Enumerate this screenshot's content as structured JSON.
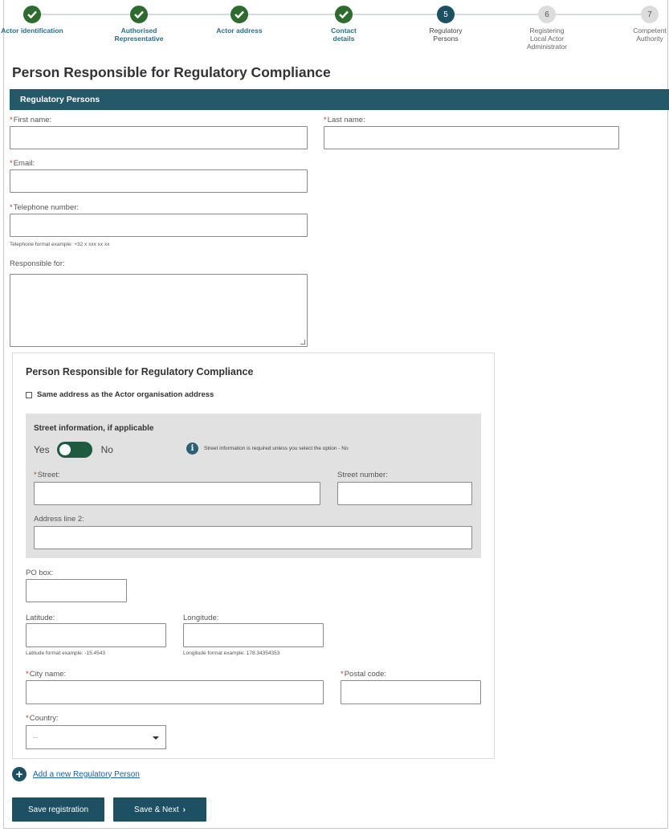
{
  "stepper": {
    "steps": [
      {
        "number": "",
        "label": "Actor identification",
        "state": "done"
      },
      {
        "number": "",
        "label": "Authorised Representative",
        "state": "done"
      },
      {
        "number": "",
        "label": "Actor address",
        "state": "done"
      },
      {
        "number": "",
        "label": "Contact details",
        "state": "done"
      },
      {
        "number": "5",
        "label": "Regulatory Persons",
        "state": "current"
      },
      {
        "number": "6",
        "label": "Registering Local Actor Administrator",
        "state": "todo"
      },
      {
        "number": "7",
        "label": "Competent Authority",
        "state": "todo"
      }
    ]
  },
  "page": {
    "title": "Person Responsible for Regulatory Compliance",
    "section_title": "Regulatory Persons"
  },
  "person": {
    "first_name_label": "First name:",
    "first_name_value": "",
    "last_name_label": "Last name:",
    "last_name_value": "",
    "email_label": "Email:",
    "email_value": "",
    "phone_label": "Telephone number:",
    "phone_value": "",
    "phone_hint": "Telephone format example: +32 x xxx xx xx",
    "responsible_label": "Responsible for:",
    "responsible_value": ""
  },
  "address_panel": {
    "title": "Person Responsible for Regulatory Compliance",
    "same_address_label": "Same address as the Actor organisation address",
    "same_address_checked": false,
    "street_info_title": "Street information, if applicable",
    "toggle_yes": "Yes",
    "toggle_no": "No",
    "toggle_state": "Yes",
    "info_text": "Street information is required unless you select the option - No",
    "street_label": "Street:",
    "street_number_label": "Street number:",
    "address_line2_label": "Address line 2:",
    "po_box_label": "PO box:",
    "latitude_label": "Latitude:",
    "latitude_hint": "Latitude format example: -15.4543",
    "longitude_label": "Longitude:",
    "longitude_hint": "Longitude format example: 178.34354353",
    "city_label": "City name:",
    "postal_label": "Postal code:",
    "country_label": "Country:",
    "country_value": "--"
  },
  "actions": {
    "add_person": "Add a new Regulatory Person",
    "save_registration": "Save registration",
    "save_next": "Save & Next",
    "save_next_chevron": "›"
  },
  "colors": {
    "accent": "#255869",
    "done_green": "#2e6b2e",
    "required_red": "#c0392b",
    "link_blue": "#1a5fa8"
  }
}
